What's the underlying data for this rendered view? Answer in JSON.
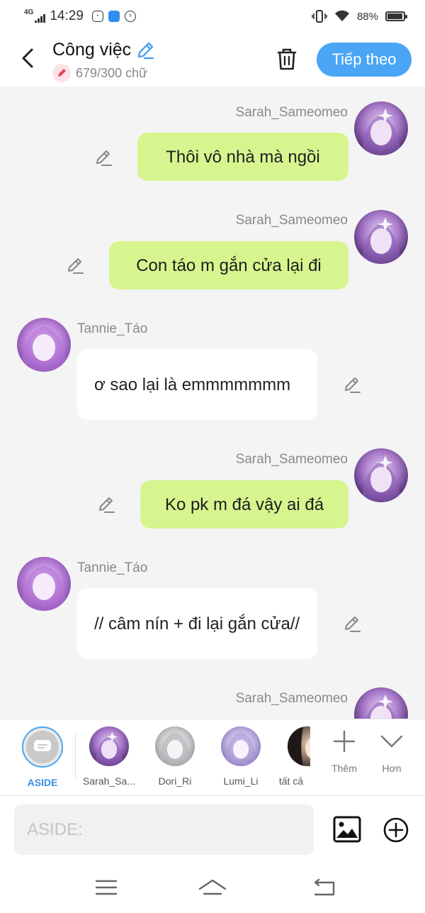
{
  "status_bar": {
    "network": "4G",
    "time": "14:29",
    "battery": "88%",
    "battery_level": 0.88
  },
  "header": {
    "title": "Công việc",
    "word_count": "679/300 chữ",
    "next_label": "Tiếp theo"
  },
  "messages": [
    {
      "sender": "Sarah_Sameomeo",
      "side": "me",
      "text": "Thôi vô nhà mà ngồi"
    },
    {
      "sender": "Sarah_Sameomeo",
      "side": "me",
      "text": "Con táo m gắn cửa lại đi"
    },
    {
      "sender": "Tannie_Táo",
      "side": "other",
      "text": "ơ sao lại là emmmmmmm"
    },
    {
      "sender": "Sarah_Sameomeo",
      "side": "me",
      "text": "Ko pk m đá vậy ai đá"
    },
    {
      "sender": "Tannie_Táo",
      "side": "other",
      "text": "// câm nín + đi lại gắn cửa//"
    },
    {
      "sender": "Sarah_Sameomeo",
      "side": "me",
      "text": ""
    }
  ],
  "characters": [
    {
      "label": "ASIDE",
      "active": true
    },
    {
      "label": "Sarah_Sa..."
    },
    {
      "label": "Dori_Ri"
    },
    {
      "label": "Lumi_Li"
    },
    {
      "label": "tất cả"
    }
  ],
  "tools": {
    "add_label": "Thêm",
    "more_label": "Hơn"
  },
  "input": {
    "placeholder": "ASIDE:"
  },
  "colors": {
    "accent": "#4aa6f5",
    "my_bubble": "#d7f58f",
    "other_bubble": "#ffffff",
    "background": "#f4f4f4"
  }
}
